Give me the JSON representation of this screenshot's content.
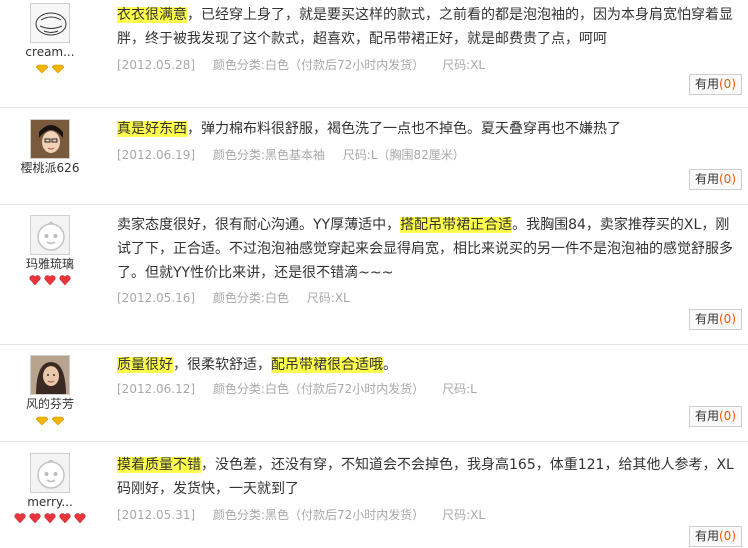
{
  "reviews": [
    {
      "user": "cream...",
      "highlight": "衣衣很满意",
      "text": "，已经穿上身了，就是要买这样的款式，之前看的都是泡泡袖的，因为本身肩宽怕穿着显胖，终于被我发现了这个款式，超喜欢，配吊带裙正好，就是邮费贵了点，呵呵",
      "date": "[2012.05.28]",
      "color": "颜色分类:白色（付款后72小时内发货）",
      "size": "尺码:XL",
      "useful_label": "有用",
      "useful_count": "(0)"
    },
    {
      "user": "樱桃派626",
      "highlight": "真是好东西",
      "text": "，弹力棉布料很舒服，褐色洗了一点也不掉色。夏天叠穿再也不嫌热了",
      "date": "[2012.06.19]",
      "color": "颜色分类:黑色基本袖",
      "size": "尺码:L（胸围82厘米）",
      "useful_label": "有用",
      "useful_count": "(0)"
    },
    {
      "user": "玛雅琉璃",
      "pre": "卖家态度很好，很有耐心沟通。YY厚薄适中，",
      "highlight": "搭配吊带裙正合适",
      "text": "。我胸围84，卖家推荐买的XL，刚试了下，正合适。不过泡泡袖感觉穿起来会显得肩宽，相比来说买的另一件不是泡泡袖的感觉舒服多了。但就YY性价比来讲，还是很不错滴~~~",
      "date": "[2012.05.16]",
      "color": "颜色分类:白色",
      "size": "尺码:XL",
      "useful_label": "有用",
      "useful_count": "(0)"
    },
    {
      "user": "风的芬芳",
      "highlight": "质量很好",
      "mid": "，很柔软舒适，",
      "highlight2": "配吊带裙很合适哦",
      "text": "。",
      "date": "[2012.06.12]",
      "color": "颜色分类:白色（付款后72小时内发货）",
      "size": "尺码:L",
      "useful_label": "有用",
      "useful_count": "(0)"
    },
    {
      "user": "merry...",
      "highlight": "摸着质量不错",
      "text": "，没色差，还没有穿，不知道会不会掉色，我身高165，体重121，给其他人参考，XL码刚好，发货快，一天就到了",
      "date": "[2012.05.31]",
      "color": "颜色分类:黑色（付款后72小时内发货）",
      "size": "尺码:XL",
      "useful_label": "有用",
      "useful_count": "(0)"
    }
  ]
}
